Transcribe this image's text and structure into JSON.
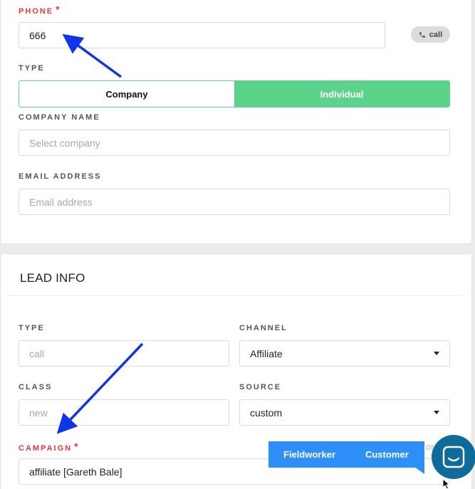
{
  "contact": {
    "phone_label": "PHONE",
    "phone_value": "666",
    "call_label": "call",
    "type_label": "TYPE",
    "type_options": [
      "Company",
      "Individual"
    ],
    "type_selected": "Individual",
    "company_label": "COMPANY NAME",
    "company_placeholder": "Select company",
    "email_label": "EMAIL ADDRESS",
    "email_placeholder": "Email address"
  },
  "lead": {
    "title": "LEAD INFO",
    "type_label": "TYPE",
    "type_value": "call",
    "channel_label": "CHANNEL",
    "channel_value": "Affiliate",
    "class_label": "CLASS",
    "class_value": "new",
    "source_label": "SOURCE",
    "source_value": "custom",
    "campaign_label": "CAMPAIGN",
    "campaign_value": "affiliate [Gareth Bale]",
    "partial_text": "or"
  },
  "overlay": {
    "chip_items": [
      "Fieldworker",
      "Customer"
    ]
  },
  "colors": {
    "required": "#e8383d",
    "toggle_active": "#5cd38a",
    "chip": "#2d8ff7",
    "chat_button": "#0f6b99",
    "annotation_arrow": "#1034e8"
  }
}
